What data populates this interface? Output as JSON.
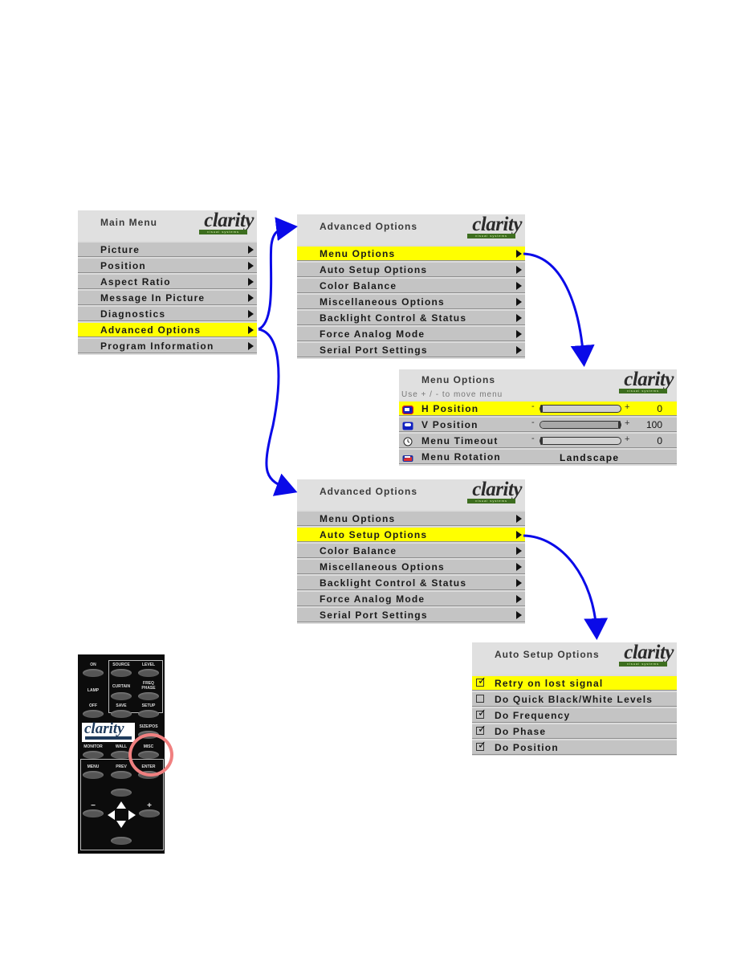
{
  "main_menu": {
    "title": "Main Menu",
    "logo": "clarity",
    "logo_sub": "visual systems",
    "items": [
      {
        "label": "Picture",
        "selected": false
      },
      {
        "label": "Position",
        "selected": false
      },
      {
        "label": "Aspect Ratio",
        "selected": false
      },
      {
        "label": "Message In Picture",
        "selected": false
      },
      {
        "label": "Diagnostics",
        "selected": false
      },
      {
        "label": "Advanced Options",
        "selected": true
      },
      {
        "label": "Program Information",
        "selected": false
      }
    ]
  },
  "advanced_options_1": {
    "title": "Advanced Options",
    "logo": "clarity",
    "logo_sub": "visual systems",
    "items": [
      {
        "label": "Menu Options",
        "selected": true
      },
      {
        "label": "Auto Setup Options",
        "selected": false
      },
      {
        "label": "Color Balance",
        "selected": false
      },
      {
        "label": "Miscellaneous Options",
        "selected": false
      },
      {
        "label": "Backlight Control & Status",
        "selected": false
      },
      {
        "label": "Force Analog Mode",
        "selected": false
      },
      {
        "label": "Serial Port Settings",
        "selected": false
      }
    ]
  },
  "menu_options": {
    "title": "Menu Options",
    "logo": "clarity",
    "logo_sub": "visual systems",
    "hint": "Use + / - to move menu",
    "items": [
      {
        "label": "H Position",
        "icon": "h-position-icon",
        "type": "slider",
        "value": "0",
        "level": 0.0,
        "selected": true
      },
      {
        "label": "V Position",
        "icon": "v-position-icon",
        "type": "slider",
        "value": "100",
        "level": 1.0,
        "selected": false
      },
      {
        "label": "Menu Timeout",
        "icon": "clock-icon",
        "type": "slider",
        "value": "0",
        "level": 0.0,
        "selected": false
      },
      {
        "label": "Menu Rotation",
        "icon": "rotation-icon",
        "type": "option",
        "value": "Landscape",
        "selected": false
      }
    ],
    "minus": "-",
    "plus": "+"
  },
  "advanced_options_2": {
    "title": "Advanced Options",
    "logo": "clarity",
    "logo_sub": "visual systems",
    "items": [
      {
        "label": "Menu Options",
        "selected": false
      },
      {
        "label": "Auto Setup Options",
        "selected": true
      },
      {
        "label": "Color Balance",
        "selected": false
      },
      {
        "label": "Miscellaneous Options",
        "selected": false
      },
      {
        "label": "Backlight Control & Status",
        "selected": false
      },
      {
        "label": "Force Analog Mode",
        "selected": false
      },
      {
        "label": "Serial Port Settings",
        "selected": false
      }
    ]
  },
  "auto_setup_options": {
    "title": "Auto Setup Options",
    "logo": "clarity",
    "logo_sub": "visual systems",
    "items": [
      {
        "label": "Retry on lost signal",
        "checked": true,
        "selected": true
      },
      {
        "label": "Do Quick Black/White Levels",
        "checked": false,
        "selected": false
      },
      {
        "label": "Do Frequency",
        "checked": true,
        "selected": false
      },
      {
        "label": "Do Phase",
        "checked": true,
        "selected": false
      },
      {
        "label": "Do Position",
        "checked": true,
        "selected": false
      }
    ]
  },
  "remote": {
    "logo": "clarity",
    "buttons": {
      "on": "ON",
      "lamp": "LAMP",
      "off": "OFF",
      "source": "SOURCE",
      "level": "LEVEL",
      "curtain": "CURTAIN",
      "freq_phase": "FREQ PHASE",
      "save": "SAVE",
      "setup": "SETUP",
      "size_pos": "SIZE/POS",
      "monitor": "MONITOR",
      "wall": "WALL",
      "misc": "MISC",
      "menu": "MENU",
      "prev": "PREV",
      "enter": "ENTER",
      "minus": "−",
      "plus": "+"
    },
    "highlighted_button": "MISC"
  },
  "colors": {
    "selected_row": "#ffff00",
    "row_bg": "#c4c4c4",
    "arrow_blue": "#0a0ae8",
    "highlight_circle": "#f08080"
  }
}
